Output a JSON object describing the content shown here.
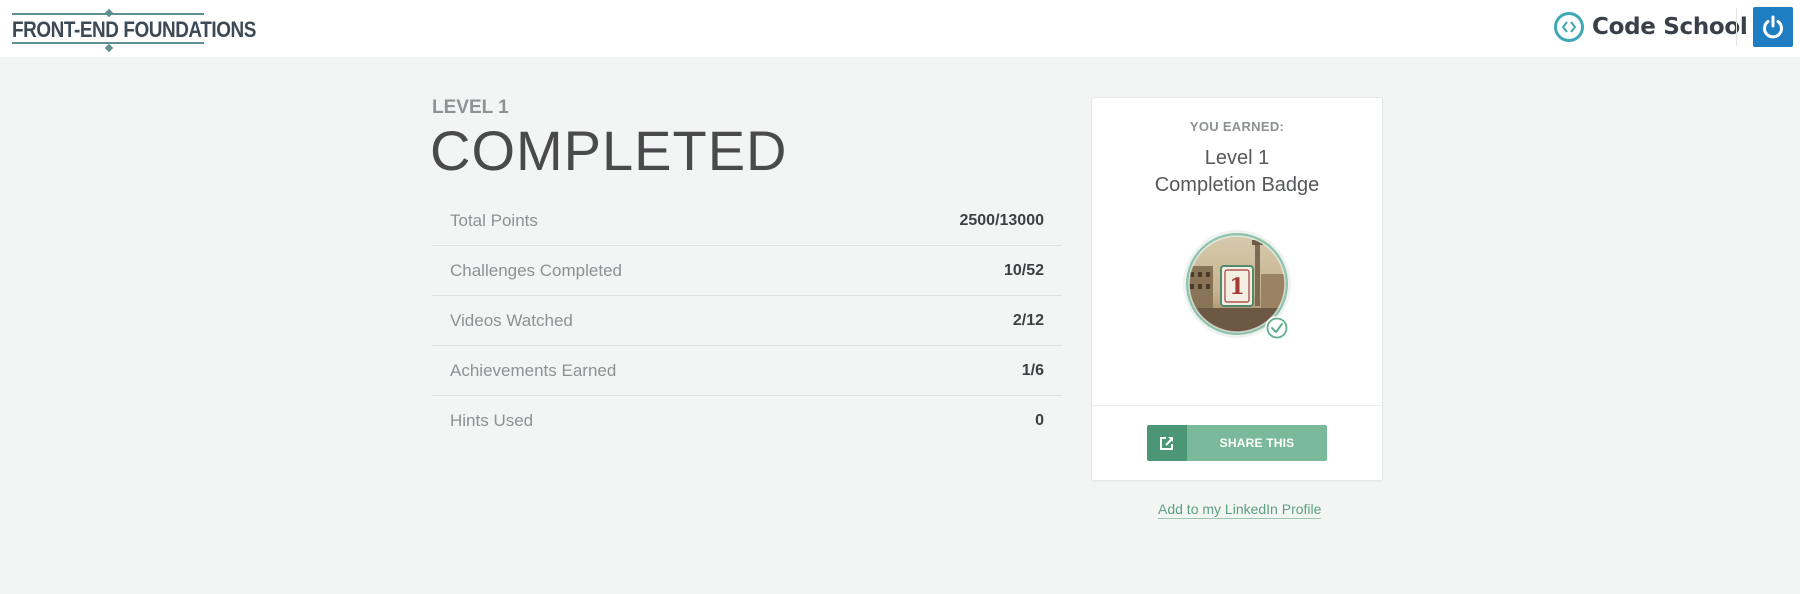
{
  "header": {
    "course_logo_text": "FRONT-END FOUNDATIONS",
    "brand_name": "Code School",
    "colors": {
      "brand_teal": "#3fa8b8",
      "power_blue": "#1f7ec1",
      "logo_slate": "#5e8f93"
    },
    "icons": {
      "brand": "code-brackets-icon",
      "account": "power-icon"
    }
  },
  "main": {
    "level_label": "LEVEL 1",
    "title": "COMPLETED",
    "stats": [
      {
        "label": "Total Points",
        "value": "2500/13000"
      },
      {
        "label": "Challenges Completed",
        "value": "10/52"
      },
      {
        "label": "Videos Watched",
        "value": "2/12"
      },
      {
        "label": "Achievements Earned",
        "value": "1/6"
      },
      {
        "label": "Hints Used",
        "value": "0"
      }
    ]
  },
  "badge_card": {
    "earned_label": "YOU EARNED:",
    "badge_name_line1": "Level 1",
    "badge_name_line2": "Completion Badge",
    "badge_number": "1",
    "share_label": "SHARE THIS",
    "icons": {
      "share": "share-icon",
      "check": "check-icon"
    },
    "colors": {
      "share_dark": "#4b9775",
      "share_light": "#7ab99a"
    }
  },
  "linkedin_link": "Add to my LinkedIn Profile"
}
